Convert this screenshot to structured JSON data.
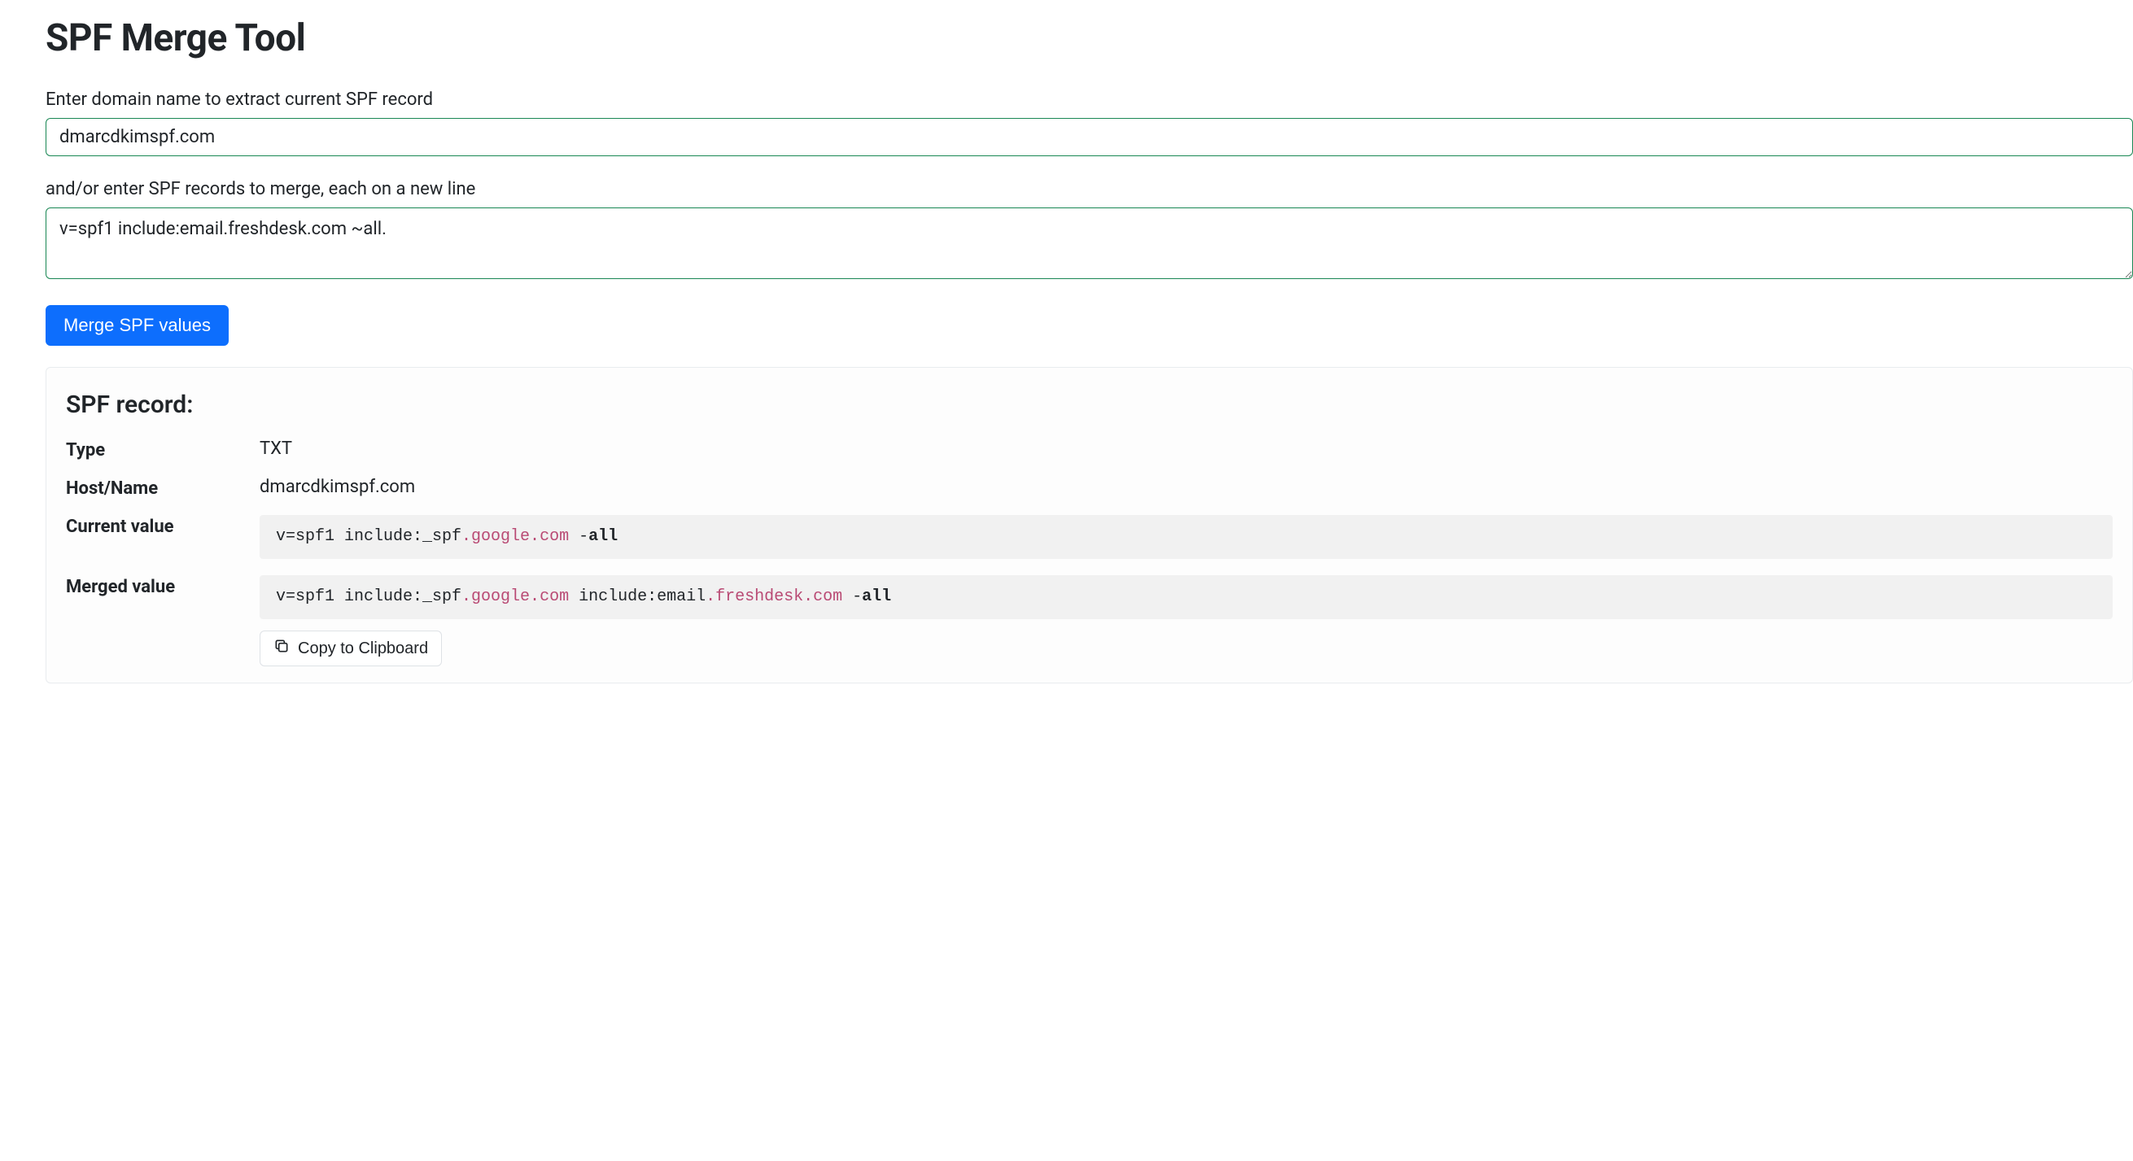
{
  "title": "SPF Merge Tool",
  "form": {
    "domain_label": "Enter domain name to extract current SPF record",
    "domain_value": "dmarcdkimspf.com",
    "records_label": "and/or enter SPF records to merge, each on a new line",
    "records_value": "v=spf1 include:email.freshdesk.com ~all.",
    "submit_label": "Merge SPF values"
  },
  "result": {
    "heading": "SPF record:",
    "rows": {
      "type_label": "Type",
      "type_value": "TXT",
      "host_label": "Host/Name",
      "host_value": "dmarcdkimspf.com",
      "current_label": "Current value",
      "merged_label": "Merged value"
    },
    "current_tokens": [
      {
        "text": "v=spf1 include:_spf",
        "cls": "t1"
      },
      {
        "text": ".google.com",
        "cls": "t2"
      },
      {
        "text": " -",
        "cls": "t1"
      },
      {
        "text": "all",
        "cls": "t3"
      }
    ],
    "merged_tokens": [
      {
        "text": "v=spf1 include:_spf",
        "cls": "t1"
      },
      {
        "text": ".google.com",
        "cls": "t2"
      },
      {
        "text": " include:email",
        "cls": "t1"
      },
      {
        "text": ".freshdesk.com",
        "cls": "t2"
      },
      {
        "text": " -",
        "cls": "t1"
      },
      {
        "text": "all",
        "cls": "t3"
      }
    ],
    "copy_label": "Copy to Clipboard"
  }
}
